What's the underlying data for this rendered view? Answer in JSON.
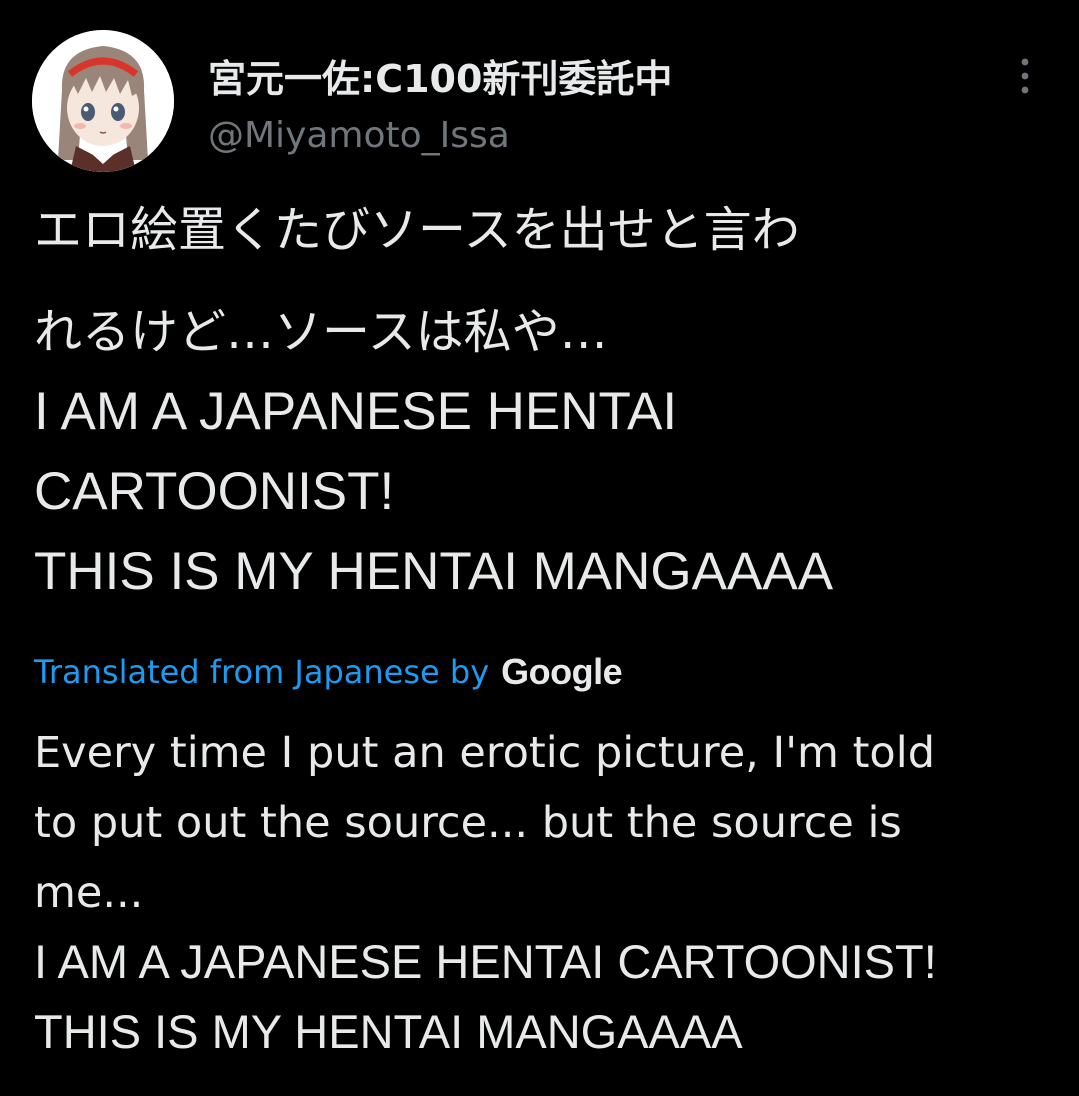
{
  "author": {
    "display_name": "宮元一佐:C100新刊委託中",
    "handle": "@Miyamoto_Issa",
    "avatar_icon": "anime-girl-avatar"
  },
  "more_icon": "more-vertical-icon",
  "tweet": {
    "original_lines": [
      "エロ絵置くたびソースを出せと言わ",
      "れるけど…ソースは私や…",
      "I AM A JAPANESE HENTAI",
      "CARTOONIST!",
      "THIS IS MY HENTAI MANGAAAA"
    ],
    "translated_label": "Translated from Japanese by",
    "translator_brand": "Google",
    "translation_lines": [
      "Every time I put an erotic picture, I'm told",
      "to put out the source... but the source is",
      "me...",
      "I AM A JAPANESE HENTAI CARTOONIST!",
      "THIS IS MY HENTAI MANGAAAA"
    ]
  },
  "colors": {
    "background": "#000000",
    "text_primary": "#e7e9ea",
    "text_secondary": "#71767b",
    "link": "#1d9bf0"
  }
}
